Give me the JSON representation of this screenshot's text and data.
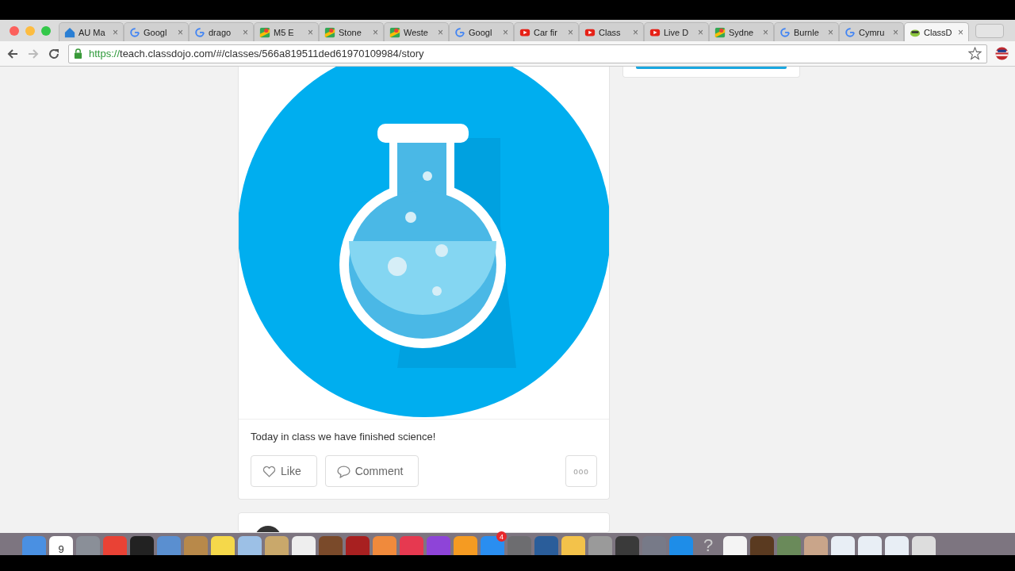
{
  "tabs": [
    {
      "label": "AU Ma",
      "kind": "au",
      "close": "×",
      "selected": false
    },
    {
      "label": "Googl",
      "kind": "google",
      "close": "×",
      "selected": false
    },
    {
      "label": "drago",
      "kind": "google",
      "close": "×",
      "selected": false
    },
    {
      "label": "M5 E",
      "kind": "maps",
      "close": "×",
      "selected": false
    },
    {
      "label": "Stone",
      "kind": "maps",
      "close": "×",
      "selected": false
    },
    {
      "label": "Weste",
      "kind": "maps",
      "close": "×",
      "selected": false
    },
    {
      "label": "Googl",
      "kind": "google",
      "close": "×",
      "selected": false
    },
    {
      "label": "Car fir",
      "kind": "youtube",
      "close": "×",
      "selected": false
    },
    {
      "label": "Class",
      "kind": "youtube",
      "close": "×",
      "selected": false
    },
    {
      "label": "Live D",
      "kind": "youtube",
      "close": "×",
      "selected": false
    },
    {
      "label": "Sydne",
      "kind": "maps",
      "close": "×",
      "selected": false
    },
    {
      "label": "Burnle",
      "kind": "google",
      "close": "×",
      "selected": false
    },
    {
      "label": "Cymru",
      "kind": "google",
      "close": "×",
      "selected": false
    },
    {
      "label": "ClassD",
      "kind": "dojo",
      "close": "×",
      "selected": true
    }
  ],
  "address": {
    "scheme": "https://",
    "rest": "teach.classdojo.com/#/classes/566a819511ded61970109984/story"
  },
  "post": {
    "caption": "Today in class we have finished science!",
    "like": "Like",
    "comment": "Comment",
    "more": "ooo"
  },
  "dock": [
    {
      "kind": "app",
      "color": "#4a90e2"
    },
    {
      "kind": "calendar",
      "text": "9"
    },
    {
      "kind": "app",
      "color": "#8a8f98"
    },
    {
      "kind": "app",
      "color": "#e94235"
    },
    {
      "kind": "app",
      "color": "#222222"
    },
    {
      "kind": "app",
      "color": "#5a8fd0"
    },
    {
      "kind": "app",
      "color": "#b8894a"
    },
    {
      "kind": "app",
      "color": "#f5d84a"
    },
    {
      "kind": "app",
      "color": "#9cc0e6"
    },
    {
      "kind": "app",
      "color": "#c9a86b"
    },
    {
      "kind": "app",
      "color": "#eeeeee"
    },
    {
      "kind": "app",
      "color": "#7a4a2a"
    },
    {
      "kind": "app",
      "color": "#a82020"
    },
    {
      "kind": "app",
      "color": "#f08a3c"
    },
    {
      "kind": "app",
      "color": "#e63950"
    },
    {
      "kind": "app",
      "color": "#8e44d8"
    },
    {
      "kind": "app",
      "color": "#f59b22"
    },
    {
      "kind": "badge",
      "color": "#2a8ef0",
      "text": "4"
    },
    {
      "kind": "app",
      "color": "#6d6d70"
    },
    {
      "kind": "app",
      "color": "#2a5d9a"
    },
    {
      "kind": "app",
      "color": "#f3c24a"
    },
    {
      "kind": "app",
      "color": "#9a9a9a"
    },
    {
      "kind": "app",
      "color": "#3a3a3a"
    },
    {
      "kind": "app",
      "color": "#777a88"
    },
    {
      "kind": "app",
      "color": "#1e8de8"
    },
    {
      "kind": "help",
      "text": "?"
    },
    {
      "kind": "app",
      "color": "#f4f4f4"
    },
    {
      "kind": "app",
      "color": "#5a3a20"
    },
    {
      "kind": "app",
      "color": "#6a8a5a"
    },
    {
      "kind": "app",
      "color": "#c9a58a"
    },
    {
      "kind": "app",
      "color": "#e8eef5"
    },
    {
      "kind": "app",
      "color": "#e8eef5"
    },
    {
      "kind": "app",
      "color": "#e8eef5"
    },
    {
      "kind": "app",
      "color": "#dddddd"
    }
  ]
}
